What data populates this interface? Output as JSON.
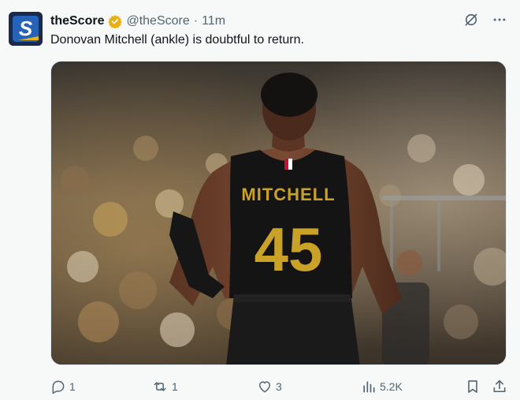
{
  "author": {
    "name": "theScore",
    "handle": "@theScore",
    "separator": "·",
    "time": "11m",
    "avatar_letter": "S"
  },
  "tweet": {
    "text": "Donovan Mitchell (ankle) is doubtful to return."
  },
  "media": {
    "jersey_name": "MITCHELL",
    "jersey_number": "45"
  },
  "actions": {
    "replies": "1",
    "reposts": "1",
    "likes": "3",
    "views": "5.2K"
  },
  "colors": {
    "text_primary": "#0f1419",
    "text_secondary": "#536471",
    "verified": "#e8b214",
    "background": "#f7f9f9",
    "jersey_gold": "#c9a227"
  }
}
